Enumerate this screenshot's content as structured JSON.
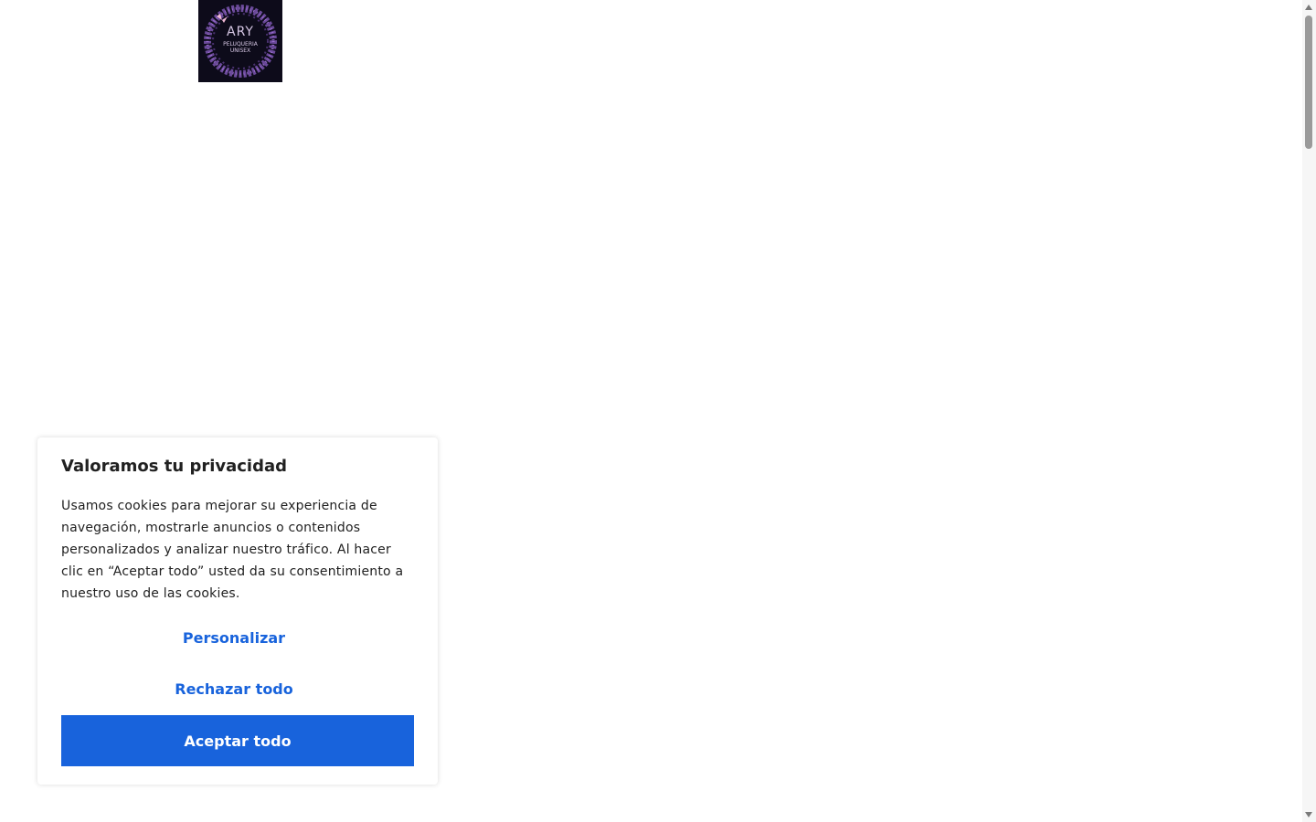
{
  "brand": {
    "logo_title": "ARY",
    "logo_line1": "PELUQUERIA",
    "logo_line2": "UNISEX",
    "logo_background": "#0d0b1a",
    "logo_accent": "#8b5fbf"
  },
  "cookie_banner": {
    "title": "Valoramos tu privacidad",
    "text": "Usamos cookies para mejorar su experiencia de navegación, mostrarle anuncios o contenidos personalizados y analizar nuestro tráfico. Al hacer clic en “Aceptar todo” usted da su consentimiento a nuestro uso de las cookies.",
    "customize_label": "Personalizar",
    "reject_label": "Rechazar todo",
    "accept_label": "Aceptar todo",
    "accent_color": "#1863dc"
  }
}
